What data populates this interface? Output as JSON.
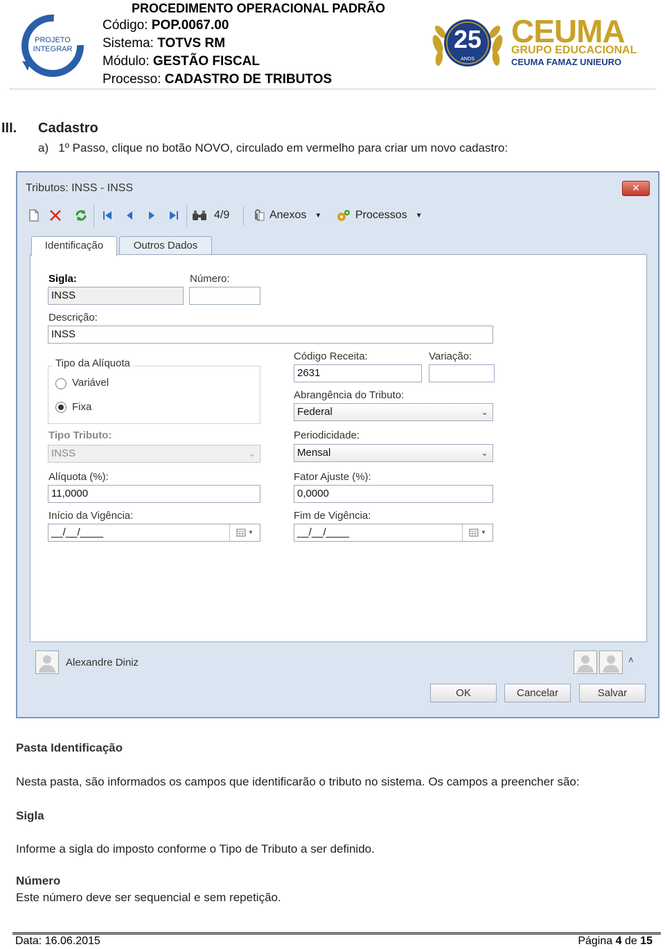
{
  "header": {
    "title": "PROCEDIMENTO OPERACIONAL PADRÃO",
    "codigo_label": "Código:",
    "codigo": "POP.0067.00",
    "sistema_label": "Sistema:",
    "sistema": "TOTVS RM",
    "modulo_label": "Módulo:",
    "modulo": "GESTÃO FISCAL",
    "processo_label": "Processo:",
    "processo": "CADASTRO DE TRIBUTOS",
    "left_logo_text": "PROJETO INTEGRAR",
    "right_logo": {
      "anniversary": "25",
      "anos": "ANOS",
      "brand": "CEUMA",
      "group": "GRUPO EDUCACIONAL",
      "members": "CEUMA FAMAZ UNIEURO"
    }
  },
  "section": {
    "number": "III.",
    "title": "Cadastro",
    "step_marker": "a)",
    "step_text": "1º Passo, clique no botão NOVO, circulado em vermelho para criar um novo cadastro:"
  },
  "window": {
    "title": "Tributos: INSS - INSS",
    "toolbar": {
      "record_counter": "4/9",
      "anexos": "Anexos",
      "processos": "Processos"
    },
    "tabs": [
      "Identificação",
      "Outros Dados"
    ],
    "form": {
      "sigla_label": "Sigla:",
      "sigla": "INSS",
      "numero_label": "Número:",
      "numero": "",
      "descricao_label": "Descrição:",
      "descricao": "INSS",
      "tipo_aliquota_label": "Tipo da Alíquota",
      "radio_variavel": "Variável",
      "radio_fixa": "Fixa",
      "tipo_tributo_label": "Tipo Tributo:",
      "tipo_tributo": "INSS",
      "aliquota_label": "Alíquota (%):",
      "aliquota": "11,0000",
      "inicio_vigencia_label": "Início da Vigência:",
      "inicio_vigencia": "__/__/____",
      "codigo_receita_label": "Código Receita:",
      "codigo_receita": "2631",
      "variacao_label": "Variação:",
      "variacao": "",
      "abrangencia_label": "Abrangência do Tributo:",
      "abrangencia": "Federal",
      "periodicidade_label": "Periodicidade:",
      "periodicidade": "Mensal",
      "fator_ajuste_label": "Fator Ajuste (%):",
      "fator_ajuste": "0,0000",
      "fim_vigencia_label": "Fim de Vigência:",
      "fim_vigencia": "__/__/____"
    },
    "user": "Alexandre Diniz",
    "buttons": {
      "ok": "OK",
      "cancelar": "Cancelar",
      "salvar": "Salvar"
    }
  },
  "body": {
    "pasta_heading": "Pasta Identificação",
    "pasta_text": "Nesta pasta, são informados os campos que identificarão o tributo no sistema. Os campos a preencher são:",
    "sigla_heading": "Sigla",
    "sigla_text": "Informe a sigla do imposto conforme o Tipo de Tributo a ser definido.",
    "numero_heading": "Número",
    "numero_text": "Este número deve ser sequencial e sem repetição."
  },
  "footer": {
    "date_label": "Data:",
    "date": "16.06.2015",
    "page_label": "Página",
    "page": "4",
    "of_label": "de",
    "total": "15"
  },
  "colors": {
    "window_bg": "#dbe5f1",
    "window_border": "#7d99bd",
    "close_button": "#c0392b",
    "logo_blue": "#1f4e96",
    "logo_gold": "#c9a227"
  }
}
